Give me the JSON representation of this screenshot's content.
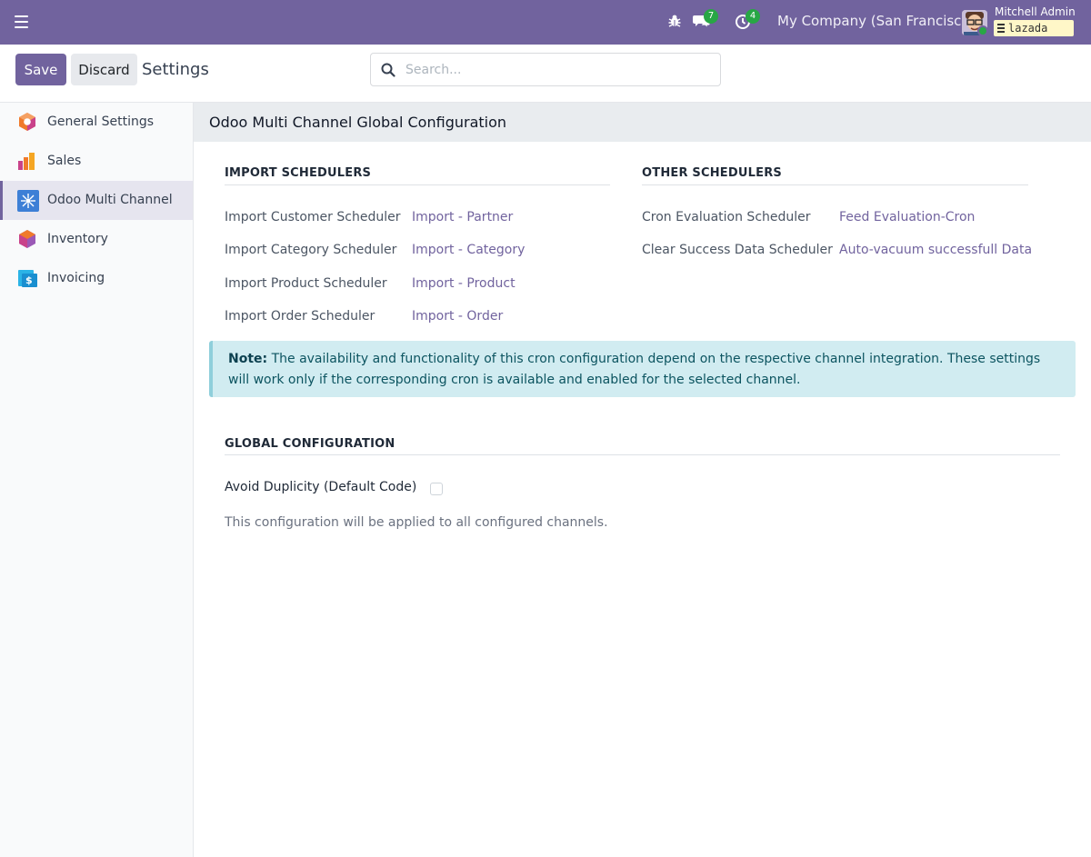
{
  "navbar": {
    "messages_count": "7",
    "activities_count": "4",
    "company": "My Company (San Francisco)",
    "user_name": "Mitchell Admin",
    "database": "lazada",
    "accent": "#71639e"
  },
  "control_panel": {
    "save_label": "Save",
    "discard_label": "Discard",
    "breadcrumb": "Settings",
    "search_placeholder": "Search..."
  },
  "sidebar": {
    "items": [
      {
        "label": "General Settings",
        "icon": "general-settings-icon"
      },
      {
        "label": "Sales",
        "icon": "sales-icon"
      },
      {
        "label": "Odoo Multi Channel",
        "icon": "multi-channel-icon",
        "active": true
      },
      {
        "label": "Inventory",
        "icon": "inventory-icon"
      },
      {
        "label": "Invoicing",
        "icon": "invoicing-icon"
      }
    ]
  },
  "main": {
    "section_title": "Odoo Multi Channel Global Configuration",
    "import_schedulers": {
      "title": "IMPORT SCHEDULERS",
      "rows": [
        {
          "label": "Import Customer Scheduler",
          "value": "Import - Partner"
        },
        {
          "label": "Import Category Scheduler",
          "value": "Import - Category"
        },
        {
          "label": "Import Product Scheduler",
          "value": "Import - Product"
        },
        {
          "label": "Import Order Scheduler",
          "value": "Import - Order"
        }
      ]
    },
    "other_schedulers": {
      "title": "OTHER SCHEDULERS",
      "rows": [
        {
          "label": "Cron Evaluation Scheduler",
          "value": "Feed Evaluation-Cron"
        },
        {
          "label": "Clear Success Data Scheduler",
          "value": "Auto-vacuum successfull Data"
        }
      ]
    },
    "note": {
      "prefix": "Note:",
      "text": " The availability and functionality of this cron configuration depend on the respective channel integration. These settings will work only if the corresponding cron is available and enabled for the selected channel."
    },
    "global_configuration": {
      "title": "GLOBAL CONFIGURATION",
      "option_label": "Avoid Duplicity (Default Code)",
      "option_checked": false,
      "help": "This configuration will be applied to all configured channels."
    }
  }
}
